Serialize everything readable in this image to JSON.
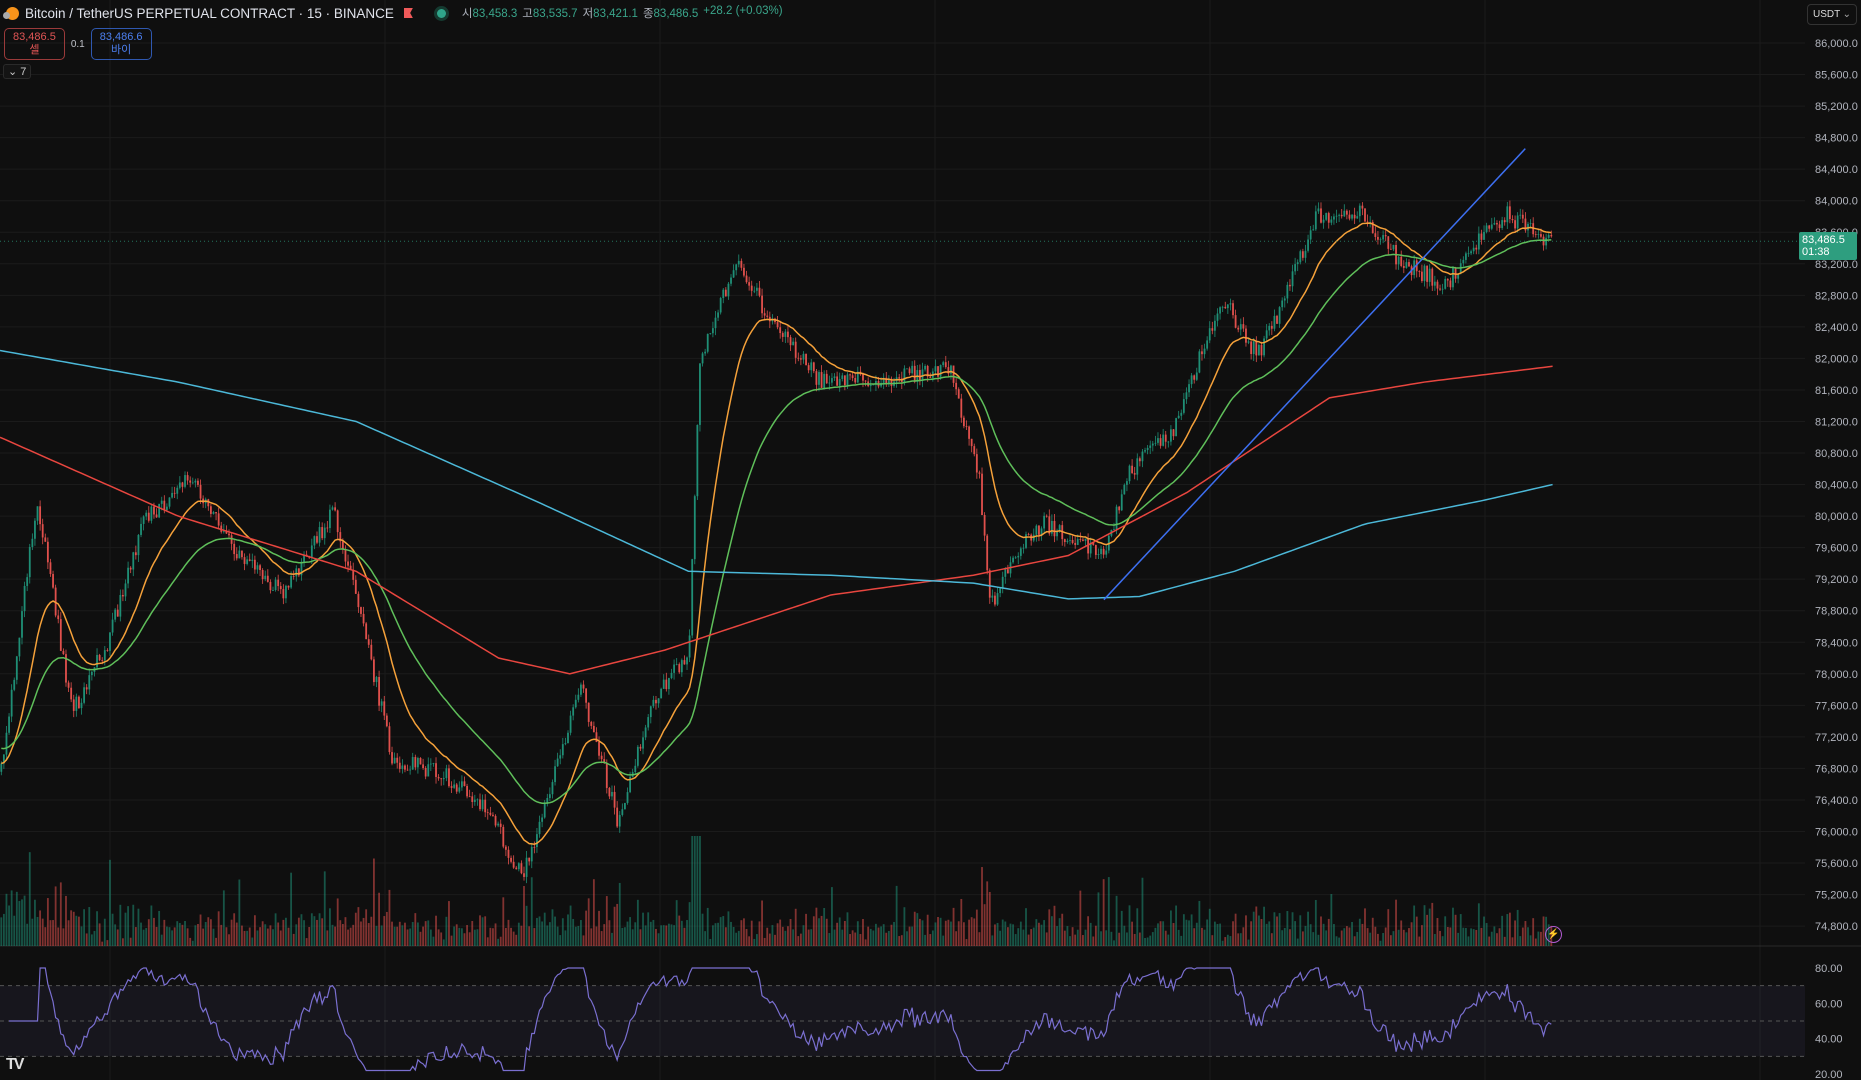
{
  "header": {
    "symbol_title": "Bitcoin / TetherUS PERPETUAL CONTRACT · 15 · BINANCE",
    "open_label": "시",
    "open": "83,458.3",
    "high_label": "고",
    "high": "83,535.7",
    "low_label": "저",
    "low": "83,421.1",
    "close_label": "종",
    "close": "83,486.5",
    "change": "+28.2 (+0.03%)"
  },
  "trade": {
    "sell_price": "83,486.5",
    "sell_label": "셀",
    "spread": "0.1",
    "buy_price": "83,486.6",
    "buy_label": "바이"
  },
  "indicators_toggle": "7",
  "currency": "USDT",
  "last_price": {
    "value": "83,486.5",
    "countdown": "01:38",
    "price": 83486.5
  },
  "colors": {
    "up": "#1f8f76",
    "down": "#e0504c",
    "ema_fast": "#f5a13a",
    "ema_mid": "#5fbf5a",
    "ma_slow": "#e8463f",
    "ma_long": "#4cb8d8",
    "trend": "#3d6ff0",
    "rsi": "#7a6fd0"
  },
  "chart_data": {
    "type": "candlestick",
    "price_axis": {
      "max": 86000,
      "min": 74800,
      "step": 400
    },
    "rsi_axis": {
      "ticks": [
        80,
        60,
        40,
        20
      ],
      "band": [
        30,
        70
      ],
      "period": 14
    },
    "bars": 600,
    "price_path": [
      [
        0,
        76757
      ],
      [
        30,
        80220
      ],
      [
        60,
        77510
      ],
      [
        90,
        78410
      ],
      [
        120,
        79920
      ],
      [
        160,
        80520
      ],
      [
        200,
        79470
      ],
      [
        240,
        79020
      ],
      [
        280,
        80070
      ],
      [
        300,
        79020
      ],
      [
        330,
        76910
      ],
      [
        370,
        76760
      ],
      [
        410,
        76300
      ],
      [
        440,
        75400
      ],
      [
        470,
        76910
      ],
      [
        490,
        77810
      ],
      [
        520,
        76150
      ],
      [
        550,
        77660
      ],
      [
        580,
        78260
      ],
      [
        590,
        82030
      ],
      [
        620,
        83230
      ],
      [
        650,
        82480
      ],
      [
        690,
        81730
      ],
      [
        740,
        81730
      ],
      [
        800,
        81880
      ],
      [
        825,
        80520
      ],
      [
        835,
        78860
      ],
      [
        860,
        79620
      ],
      [
        880,
        79920
      ],
      [
        930,
        79470
      ],
      [
        950,
        80520
      ],
      [
        990,
        81130
      ],
      [
        1030,
        82780
      ],
      [
        1060,
        82030
      ],
      [
        1080,
        82630
      ],
      [
        1110,
        83830
      ],
      [
        1150,
        83830
      ],
      [
        1180,
        83230
      ],
      [
        1220,
        82930
      ],
      [
        1240,
        83380
      ],
      [
        1270,
        83830
      ],
      [
        1308,
        83460
      ]
    ],
    "ema_periods": [
      20,
      50
    ],
    "ma_slow_path": [
      [
        0,
        81000
      ],
      [
        150,
        80000
      ],
      [
        300,
        79300
      ],
      [
        420,
        78200
      ],
      [
        480,
        78000
      ],
      [
        560,
        78300
      ],
      [
        620,
        78600
      ],
      [
        700,
        79000
      ],
      [
        820,
        79250
      ],
      [
        900,
        79500
      ],
      [
        1000,
        80300
      ],
      [
        1120,
        81500
      ],
      [
        1200,
        81700
      ],
      [
        1308,
        81900
      ]
    ],
    "ma_long_path": [
      [
        0,
        82100
      ],
      [
        150,
        81700
      ],
      [
        300,
        81200
      ],
      [
        450,
        80200
      ],
      [
        580,
        79300
      ],
      [
        700,
        79250
      ],
      [
        820,
        79150
      ],
      [
        900,
        78950
      ],
      [
        960,
        78980
      ],
      [
        1040,
        79300
      ],
      [
        1150,
        79900
      ],
      [
        1250,
        80200
      ],
      [
        1308,
        80400
      ]
    ],
    "trendline": [
      [
        930,
        78940
      ],
      [
        1285,
        84660
      ]
    ]
  }
}
